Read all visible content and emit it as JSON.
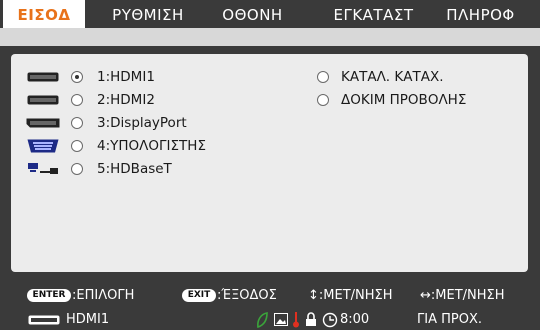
{
  "tabs": [
    {
      "label": "ΕΙΣΟΔ",
      "active": true
    },
    {
      "label": "ΡΥΘΜΙΣΗ",
      "active": false
    },
    {
      "label": "ΟΘΟΝΗ",
      "active": false
    },
    {
      "label": "ΕΓΚΑΤΑΣΤ",
      "active": false
    },
    {
      "label": "ΠΛΗΡΟΦ",
      "active": false
    }
  ],
  "inputs": [
    {
      "label": "1:HDMI1",
      "selected": true,
      "icon": "hdmi-icon"
    },
    {
      "label": "2:HDMI2",
      "selected": false,
      "icon": "hdmi-icon"
    },
    {
      "label": "3:DisplayPort",
      "selected": false,
      "icon": "displayport-icon"
    },
    {
      "label": "4:ΥΠΟΛΟΓΙΣΤΗΣ",
      "selected": false,
      "icon": "vga-icon"
    },
    {
      "label": "5:HDBaseT",
      "selected": false,
      "icon": "hdbaset-icon"
    }
  ],
  "right_options": [
    {
      "label": "ΚΑΤΑΛ. ΚΑΤΑΧ.",
      "selected": false
    },
    {
      "label": "ΔΟΚΙΜ ΠΡΟΒΟΛΗΣ",
      "selected": false
    }
  ],
  "help": {
    "enter_key": "ENTER",
    "enter_text": ":ΕΠΙΛΟΓΗ",
    "exit_key": "EXIT",
    "exit_text": ":ΈΞΟΔΟΣ",
    "move_v_text": "↕:ΜΕΤ/ΝΗΣΗ",
    "move_h_text": "↔:ΜΕΤ/ΝΗΣΗ"
  },
  "status": {
    "source": "HDMI1",
    "time": "8:00",
    "mode": "ΓΙΑ ΠΡΟΧ."
  },
  "colors": {
    "accent": "#e8721a",
    "eco_leaf": "#3aa43a",
    "thermo": "#e03020"
  }
}
